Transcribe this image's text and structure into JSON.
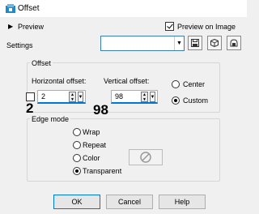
{
  "window": {
    "title": "Offset",
    "icon": "offset-app-icon",
    "accent": "#0078d7"
  },
  "toolbar": {
    "preview_label": "Preview",
    "preview_on_image_label": "Preview on Image",
    "preview_on_image_checked": true,
    "settings_label": "Settings",
    "settings_value": "",
    "icons": [
      "save-preset-icon",
      "manage-presets-icon",
      "reset-icon"
    ]
  },
  "offset": {
    "group_title": "Offset",
    "horizontal_label": "Horizontal offset:",
    "horizontal_value": "2",
    "vertical_label": "Vertical offset:",
    "vertical_value": "98",
    "horizontal_overlay": "2",
    "vertical_overlay": "98",
    "link_checked": false,
    "center_label": "Center",
    "custom_label": "Custom",
    "selected": "Custom"
  },
  "edge_mode": {
    "group_title": "Edge mode",
    "options": [
      "Wrap",
      "Repeat",
      "Color",
      "Transparent"
    ],
    "selected": "Transparent"
  },
  "buttons": {
    "ok": "OK",
    "cancel": "Cancel",
    "help": "Help"
  }
}
